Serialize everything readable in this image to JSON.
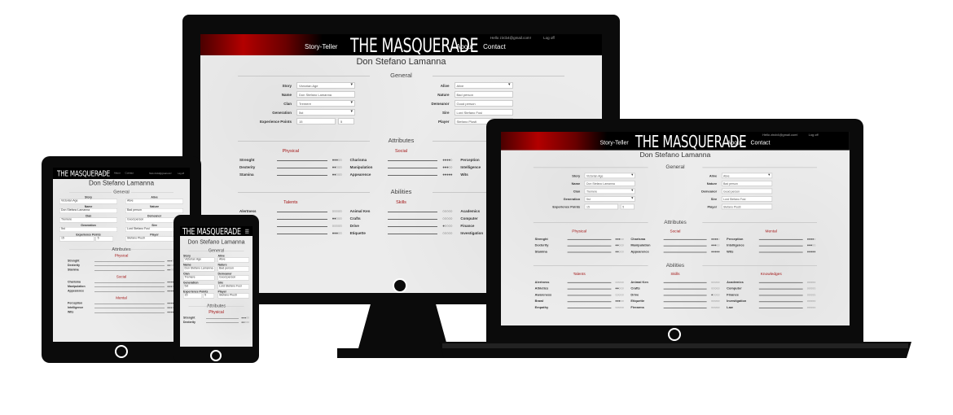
{
  "site": {
    "logo": "THE MASQUERADE",
    "nav": [
      "Story-Teller",
      "About",
      "Contact"
    ],
    "user_email": "Hello zircb4@gmail.com!",
    "logout": "Log off"
  },
  "character": {
    "name": "Don Stefano Lamanna"
  },
  "sections": {
    "general": "General",
    "attributes": "Attributes",
    "abilities": "Abilities"
  },
  "general": {
    "left": [
      {
        "label": "Story",
        "value": "Victorian Age",
        "type": "select"
      },
      {
        "label": "Name",
        "value": "Don Stefano Lamanna",
        "type": "text"
      },
      {
        "label": "Clan",
        "value": "Tremere",
        "type": "select"
      },
      {
        "label": "Generation",
        "value": "5st",
        "type": "select"
      },
      {
        "label": "Experience Points",
        "value": "15",
        "value2": "5",
        "type": "pair"
      }
    ],
    "right": [
      {
        "label": "Alive",
        "value": "Alive",
        "type": "select"
      },
      {
        "label": "Nature",
        "value": "Bad person",
        "type": "text"
      },
      {
        "label": "Demeanor",
        "value": "Good person",
        "type": "text"
      },
      {
        "label": "Sire",
        "value": "Lord Stefano Fusi",
        "type": "text"
      },
      {
        "label": "Player",
        "value": "Stefano Plusti",
        "type": "text"
      }
    ]
  },
  "attributes": {
    "groups": [
      "Physical",
      "Social",
      "Mental"
    ],
    "physical": [
      {
        "name": "Strenght",
        "dots": "●●●○○"
      },
      {
        "name": "Dexterity",
        "dots": "●●○○○"
      },
      {
        "name": "Stamina",
        "dots": "●●○○○"
      }
    ],
    "social": [
      {
        "name": "Charisma",
        "dots": "●●●●○"
      },
      {
        "name": "Manipulation",
        "dots": "●●●○○"
      },
      {
        "name": "Appearence",
        "dots": "●●●●●"
      }
    ],
    "mental": [
      {
        "name": "Perception",
        "dots": "●●●●○"
      },
      {
        "name": "Intelligence",
        "dots": "●●●○○"
      },
      {
        "name": "Wits",
        "dots": "●●●●●"
      }
    ]
  },
  "abilities": {
    "groups": [
      "Talents",
      "Skills",
      "Knowledges"
    ],
    "talents": [
      {
        "name": "Alertness",
        "dots": "○○○○○"
      },
      {
        "name": "Athletics",
        "dots": "●●○○○"
      },
      {
        "name": "Awareness",
        "dots": "○○○○○"
      },
      {
        "name": "Brawl",
        "dots": "●●●○○"
      },
      {
        "name": "Empathy",
        "dots": "○○○○○"
      }
    ],
    "skills": [
      {
        "name": "Animal Ken",
        "dots": "○○○○○"
      },
      {
        "name": "Crafts",
        "dots": "○○○○○"
      },
      {
        "name": "Drive",
        "dots": "●○○○○"
      },
      {
        "name": "Etiquette",
        "dots": "○○○○○"
      },
      {
        "name": "Firearms",
        "dots": "○○○○○"
      }
    ],
    "knowledges": [
      {
        "name": "Academics",
        "dots": "○○○○○"
      },
      {
        "name": "Computer",
        "dots": "○○○○○"
      },
      {
        "name": "Finance",
        "dots": "○○○○○"
      },
      {
        "name": "Investigation",
        "dots": "○○○○○"
      },
      {
        "name": "Law",
        "dots": "○○○○○"
      }
    ]
  },
  "colors": {
    "device": "#0b0b0b",
    "accent": "#a31515",
    "banner": "#b30000"
  }
}
